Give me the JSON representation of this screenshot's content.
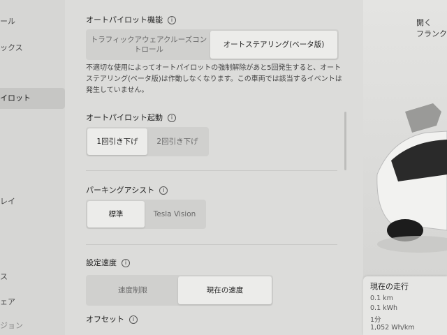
{
  "nav": {
    "items": [
      {
        "label": "ール"
      },
      {
        "label": "ックス"
      },
      {
        "label": "イロット"
      },
      {
        "label": "レイ"
      },
      {
        "label": "ス"
      },
      {
        "label": "ェア"
      },
      {
        "label": "ジョン"
      }
    ]
  },
  "autopilot_features": {
    "title": "オートパイロット機能",
    "options": [
      "トラフィックアウェアクルーズコントロール",
      "オートステアリング(ベータ版)"
    ],
    "selected": "オートステアリング(ベータ版)",
    "description": "不適切な使用によってオートパイロットの強制解除があと5回発生すると、オートステアリング(ベータ版)は作動しなくなります。この車両では該当するイベントは発生していません。"
  },
  "autopilot_activation": {
    "title": "オートパイロット起動",
    "options": [
      "1回引き下げ",
      "2回引き下げ"
    ],
    "selected": "1回引き下げ"
  },
  "parking_assist": {
    "title": "パーキングアシスト",
    "options": [
      "標準",
      "Tesla Vision"
    ],
    "selected": "標準"
  },
  "set_speed": {
    "title": "設定速度",
    "options": [
      "速度制限",
      "現在の速度"
    ],
    "selected": "現在の速度"
  },
  "offset": {
    "title": "オフセット"
  },
  "right_panel": {
    "open_label": "開く",
    "frunk_label": "フランク",
    "trip": {
      "title": "現在の走行",
      "distance": "0.1 km",
      "energy": "0.1 kWh",
      "duration": "1分",
      "efficiency": "1,052 Wh/km"
    }
  },
  "info_icon_glyph": "i"
}
